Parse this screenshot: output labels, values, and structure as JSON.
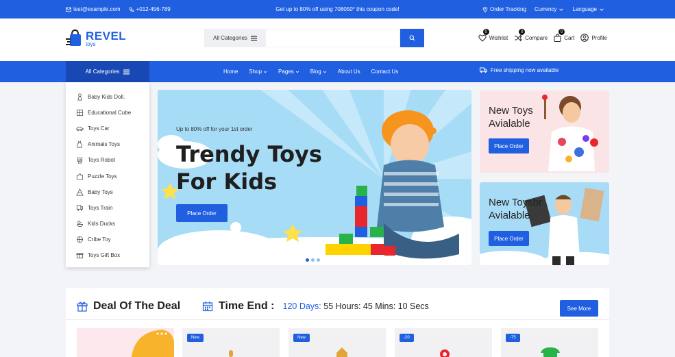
{
  "topbar": {
    "email": "test@example.com",
    "phone": "+012-456-789",
    "promo": "Get up to 80% off using 708050* this coupon code!",
    "order_tracking": "Order Tracking",
    "currency": "Currency",
    "language": "Language"
  },
  "header": {
    "logo_main": "REVEL",
    "logo_sub": "toys",
    "search_category": "All Categories",
    "search_placeholder": "",
    "wishlist": "Wishlist",
    "wishlist_count": "0",
    "compare": "Compare",
    "compare_count": "0",
    "cart": "Cart",
    "cart_count": "0",
    "profile": "Profile"
  },
  "nav": {
    "all_categories": "All Categories",
    "items": [
      {
        "label": "Home"
      },
      {
        "label": "Shop"
      },
      {
        "label": "Pages"
      },
      {
        "label": "Blog"
      },
      {
        "label": "About Us"
      },
      {
        "label": "Contact Us"
      }
    ],
    "free_shipping": "Free shipping now available"
  },
  "categories": [
    {
      "label": "Baby Kids Doll.",
      "icon": "doll-icon"
    },
    {
      "label": "Educational Cube",
      "icon": "cube-icon"
    },
    {
      "label": "Toys Car",
      "icon": "car-icon"
    },
    {
      "label": "Animals Toys",
      "icon": "animal-icon"
    },
    {
      "label": "Toys Robot",
      "icon": "robot-icon"
    },
    {
      "label": "Puzzle Toys",
      "icon": "puzzle-icon"
    },
    {
      "label": "Baby Toys",
      "icon": "baby-toy-icon"
    },
    {
      "label": "Toys Train",
      "icon": "train-icon"
    },
    {
      "label": "Kids Ducks",
      "icon": "duck-icon"
    },
    {
      "label": "Cribe Toy",
      "icon": "crib-icon"
    },
    {
      "label": "Toys Gift Box",
      "icon": "gift-icon"
    }
  ],
  "hero": {
    "subtitle": "Up to 80% off for your 1st order",
    "title_line1": "Trendy Toys",
    "title_line2": "For Kids",
    "button": "Place Order",
    "slides": 3,
    "active_slide": 1
  },
  "banners": [
    {
      "title_line1": "New Toys",
      "title_line2": "Avialable",
      "button": "Place Order"
    },
    {
      "title_line1": "New Toysbr",
      "title_line2": "Avialable",
      "button": "Place Order"
    }
  ],
  "deal": {
    "title": "Deal Of The Deal",
    "timer_label": "Time End :",
    "days": "120 Days:",
    "rest": "55 Hours: 45 Mins: 10 Secs",
    "see_more": "See More",
    "cards": [
      {
        "tag": ""
      },
      {
        "tag": "New"
      },
      {
        "tag": "New"
      },
      {
        "tag": "-20"
      },
      {
        "tag": "-75"
      }
    ]
  },
  "colors": {
    "primary": "#1f5fe0",
    "primary_dark": "#1848b4",
    "hero_bg": "#a7dcf7",
    "banner_pink": "#fbe4e6",
    "banner_blue": "#a8dcf6"
  }
}
